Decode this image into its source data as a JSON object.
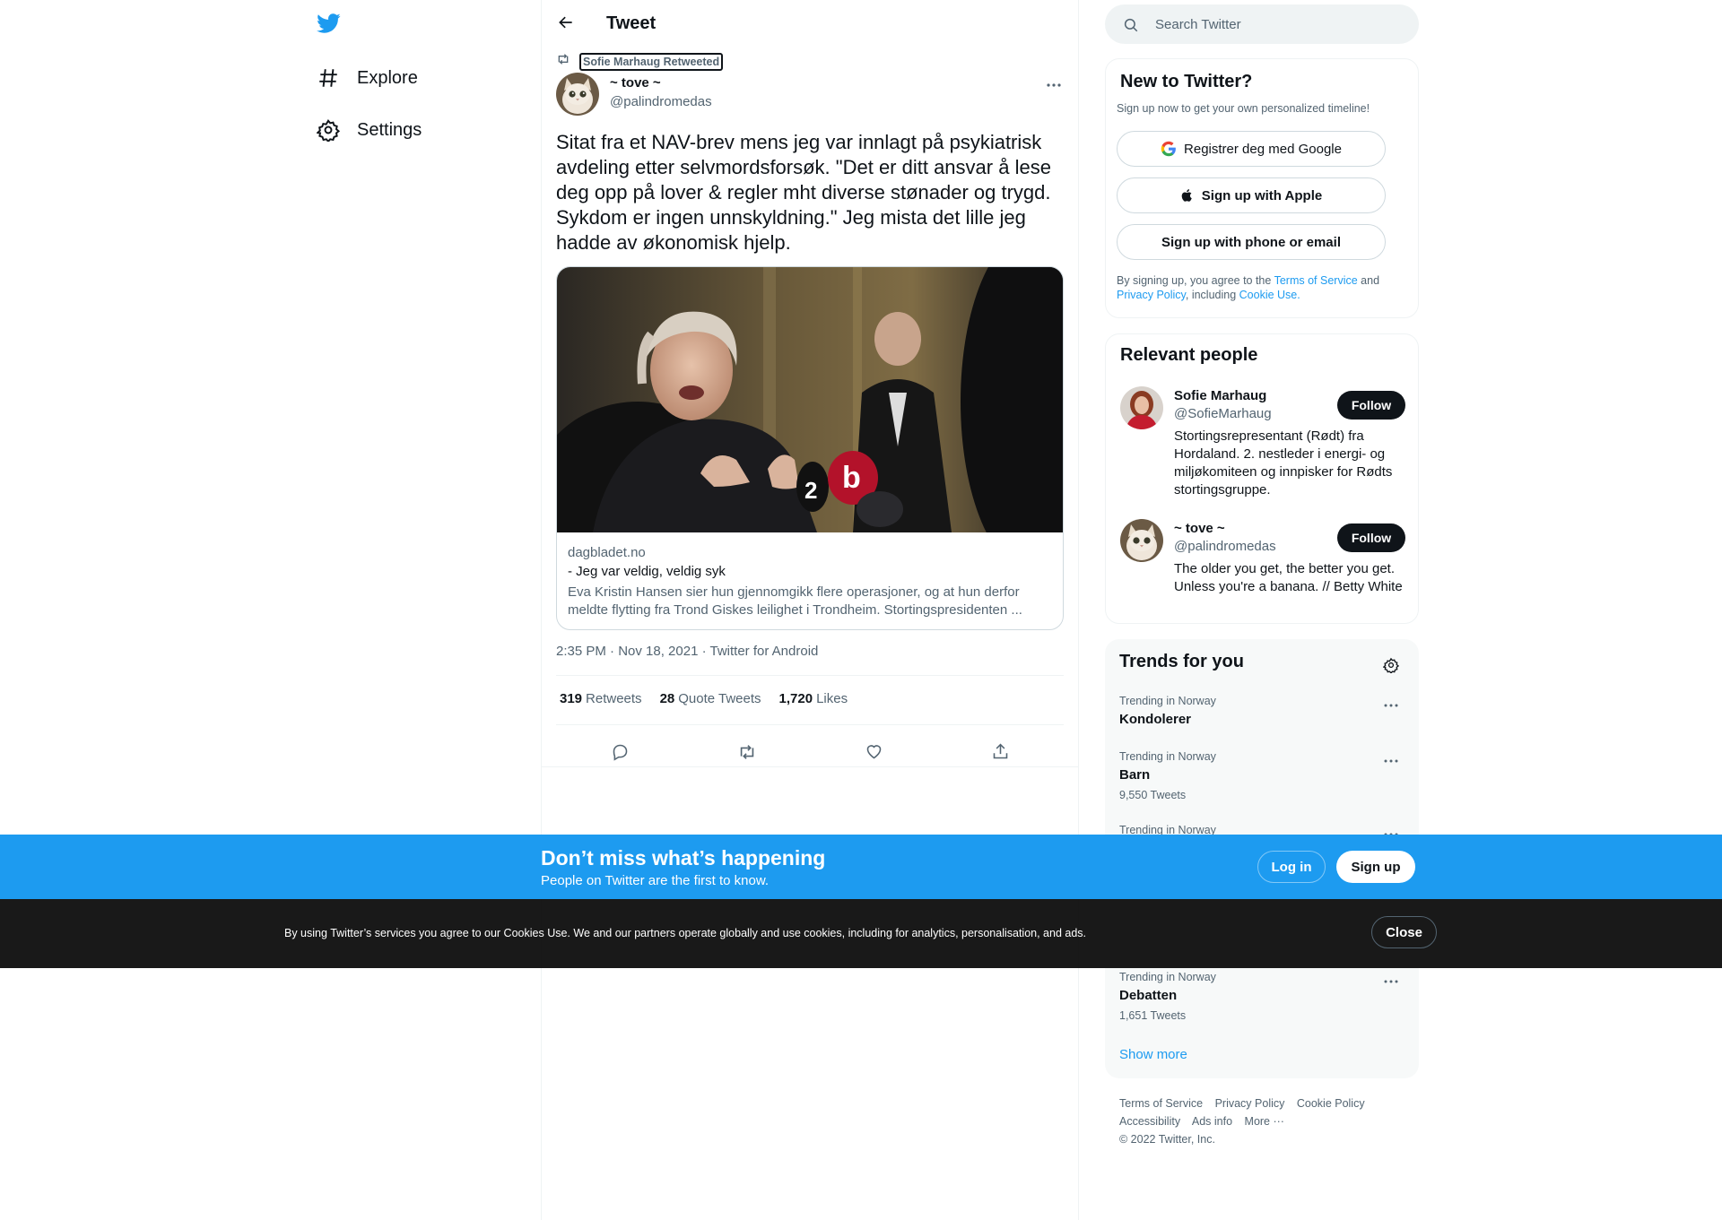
{
  "nav": {
    "items": [
      {
        "label": "Explore",
        "icon": "hashtag-icon"
      },
      {
        "label": "Settings",
        "icon": "gear-icon"
      }
    ]
  },
  "header": {
    "title": "Tweet"
  },
  "tweet": {
    "retweeted_by": "Sofie Marhaug Retweeted",
    "author_name": "~ tove ~",
    "author_handle": "@palindromedas",
    "text": "Sitat fra et NAV-brev mens jeg var innlagt på psykiatrisk avdeling etter selvmordsforsøk. \"Det er ditt ansvar å lese deg opp på lover & regler mht diverse stønader og trygd. Sykdom er ingen unnskyldning.\" Jeg mista det lille jeg hadde av økonomisk hjelp.",
    "card": {
      "domain": "dagbladet.no",
      "title": "- Jeg var veldig, veldig syk",
      "description": "Eva Kristin Hansen sier hun gjennomgikk flere operasjoner, og at hun derfor meldte flytting fra Trond Giskes leilighet i Trondheim. Stortingspresidenten ..."
    },
    "timestamp": "2:35 PM · Nov 18, 2021 · Twitter for Android",
    "stats": {
      "retweets_count": "319",
      "retweets_label": "Retweets",
      "quotes_count": "28",
      "quotes_label": "Quote Tweets",
      "likes_count": "1,720",
      "likes_label": "Likes"
    }
  },
  "search": {
    "placeholder": "Search Twitter"
  },
  "signup_panel": {
    "title": "New to Twitter?",
    "subtitle": "Sign up now to get your own personalized timeline!",
    "google_label": "Registrer deg med Google",
    "apple_label": "Sign up with Apple",
    "phone_label": "Sign up with phone or email",
    "legal_prefix": "By signing up, you agree to the ",
    "terms_link": "Terms of Service",
    "legal_and": " and ",
    "privacy_link": "Privacy Policy",
    "legal_including": ", including ",
    "cookie_link": "Cookie Use."
  },
  "people_panel": {
    "title": "Relevant people",
    "people": [
      {
        "name": "Sofie Marhaug",
        "handle": "@SofieMarhaug",
        "bio": "Stortingsrepresentant (Rødt) fra Hordaland. 2. nestleder i energi- og miljøkomiteen og innpisker for Rødts stortingsgruppe.",
        "follow_label": "Follow"
      },
      {
        "name": "~ tove ~",
        "handle": "@palindromedas",
        "bio": "The older you get, the better you get. Unless you're a banana.  // Betty White",
        "follow_label": "Follow"
      }
    ]
  },
  "trends_panel": {
    "title": "Trends for you",
    "trends": [
      {
        "context": "Trending in Norway",
        "name": "Kondolerer",
        "count": ""
      },
      {
        "context": "Trending in Norway",
        "name": "Barn",
        "count": "9,550 Tweets"
      },
      {
        "context": "Trending in Norway",
        "name": "",
        "count": ""
      },
      {
        "context": "Trending in Norway",
        "name": "Debatten",
        "count": "1,651 Tweets"
      }
    ],
    "show_more": "Show more"
  },
  "footer": {
    "links": [
      "Terms of Service",
      "Privacy Policy",
      "Cookie Policy",
      "Accessibility",
      "Ads info",
      "More ···"
    ],
    "copyright": "© 2022 Twitter, Inc."
  },
  "bottom_bar": {
    "title": "Don’t miss what’s happening",
    "subtitle": "People on Twitter are the first to know.",
    "login_label": "Log in",
    "signup_label": "Sign up"
  },
  "cookie_bar": {
    "text": "By using Twitter’s services you agree to our Cookies Use. We and our partners operate globally and use cookies, including for analytics, personalisation, and ads.",
    "close_label": "Close"
  },
  "colors": {
    "accent": "#1d9bf0",
    "text_primary": "#0f1419",
    "text_secondary": "#536471"
  }
}
